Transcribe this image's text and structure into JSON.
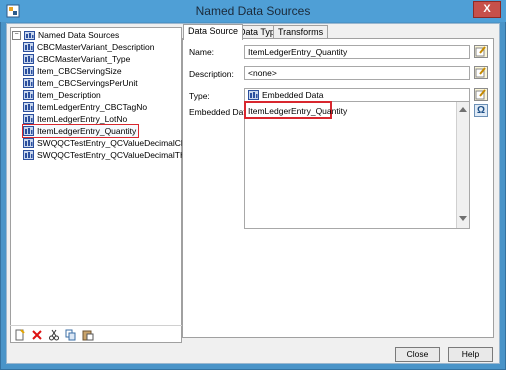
{
  "window": {
    "title": "Named Data Sources",
    "close_glyph": "X"
  },
  "tree": {
    "root_label": "Named Data Sources",
    "items": [
      {
        "label": "CBCMasterVariant_Description"
      },
      {
        "label": "CBCMasterVariant_Type"
      },
      {
        "label": "Item_CBCServingSize"
      },
      {
        "label": "Item_CBCServingsPerUnit"
      },
      {
        "label": "Item_Description"
      },
      {
        "label": "ItemLedgerEntry_CBCTagNo"
      },
      {
        "label": "ItemLedgerEntry_LotNo"
      },
      {
        "label": "ItemLedgerEntry_Quantity",
        "selected": true
      },
      {
        "label": "SWQQCTestEntry_QCValueDecimalCBD"
      },
      {
        "label": "SWQQCTestEntry_QCValueDecimalTHC"
      }
    ],
    "toolbar_icons": [
      "new-icon",
      "delete-icon",
      "cut-icon",
      "copy-icon",
      "paste-icon"
    ]
  },
  "tabs": [
    {
      "label": "Data Source",
      "active": true
    },
    {
      "label": "Data Type"
    },
    {
      "label": "Transforms"
    }
  ],
  "form": {
    "name_label": "Name:",
    "name_value": "ItemLedgerEntry_Quantity",
    "description_label": "Description:",
    "description_value": "<none>",
    "type_label": "Type:",
    "type_value": "Embedded Data",
    "embedded_label": "Embedded Data:",
    "embedded_value": "ItemLedgerEntry_Quantity",
    "omega_glyph": "Ω"
  },
  "buttons": {
    "close": "Close",
    "help": "Help"
  },
  "colors": {
    "title_bar": "#4f9fd6",
    "highlight": "#d8272e",
    "db_icon": "#2b4f9e"
  }
}
